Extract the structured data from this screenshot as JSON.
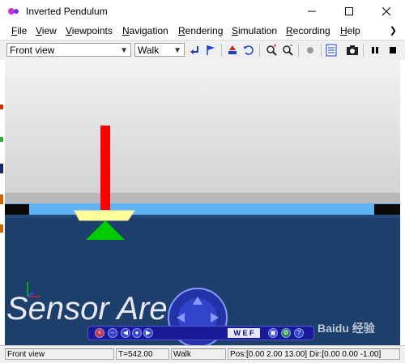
{
  "window": {
    "title": "Inverted Pendulum",
    "icon": "app-logo-icon",
    "controls": [
      "minimize-icon",
      "maximize-icon",
      "close-icon"
    ]
  },
  "menubar": {
    "items": [
      "File",
      "View",
      "Viewpoints",
      "Navigation",
      "Rendering",
      "Simulation",
      "Recording",
      "Help"
    ],
    "overflow_icon": "chevron-right-icon"
  },
  "toolbar": {
    "viewpoint_select": "Front view",
    "nav_mode_select": "Walk",
    "icons": [
      "return-arrow-icon",
      "flag-icon",
      "move-robot-icon",
      "reload-icon",
      "zoom-in-icon",
      "zoom-out-icon",
      "record-dot-icon",
      "document-icon",
      "camera-icon",
      "pause-icon",
      "stop-icon"
    ]
  },
  "scene": {
    "floor_text": "Sensor Are",
    "colors": {
      "sky": "#e6e6e6",
      "floor": "#1c3f6b",
      "wall": "#5fb3f5",
      "pole": "#ff0000",
      "cart": "#ffff99",
      "cone": "#00cc00"
    }
  },
  "navbar": {
    "wef_label": "W E F",
    "help_label": "?"
  },
  "watermark": "Baidu 经验",
  "statusbar": {
    "viewpoint": "Front view",
    "time": "T=542.00",
    "mode": "Walk",
    "position": "Pos:[0.00 2.00 13.00]  Dir:[0.00 0.00 -1.00]"
  }
}
